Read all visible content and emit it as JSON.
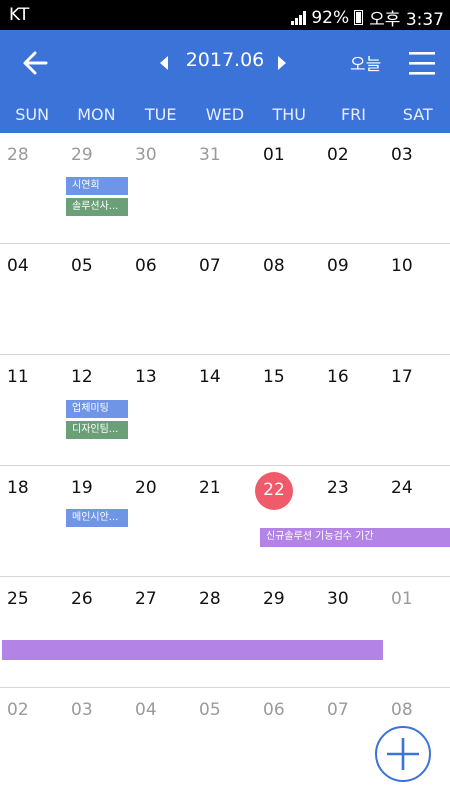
{
  "status_bar": {
    "carrier": "KT",
    "battery": "92%",
    "time": "오후 3:37"
  },
  "header": {
    "title": "2017.06",
    "today_label": "오늘"
  },
  "weekdays": [
    "SUN",
    "MON",
    "TUE",
    "WED",
    "THU",
    "FRI",
    "SAT"
  ],
  "weeks": [
    {
      "days": [
        "28",
        "29",
        "30",
        "31",
        "01",
        "02",
        "03"
      ]
    },
    {
      "days": [
        "04",
        "05",
        "06",
        "07",
        "08",
        "09",
        "10"
      ]
    },
    {
      "days": [
        "11",
        "12",
        "13",
        "14",
        "15",
        "16",
        "17"
      ]
    },
    {
      "days": [
        "18",
        "19",
        "20",
        "21",
        "22",
        "23",
        "24"
      ]
    },
    {
      "days": [
        "25",
        "26",
        "27",
        "28",
        "29",
        "30",
        "01"
      ]
    },
    {
      "days": [
        "02",
        "03",
        "04",
        "05",
        "06",
        "07",
        "08"
      ]
    }
  ],
  "events": {
    "e1": "시연회",
    "e2": "솔루션사...",
    "e3": "업체미팅",
    "e4": "디자인팀...",
    "e5": "메인시안...",
    "e6": "신규솔루션 기능검수 기간",
    "e7": ""
  },
  "colors": {
    "accent": "#3b73d9",
    "today": "#f05a6a",
    "event_blue": "#6e95e6",
    "event_green": "#6b9f78",
    "event_purple": "#b384e6"
  }
}
